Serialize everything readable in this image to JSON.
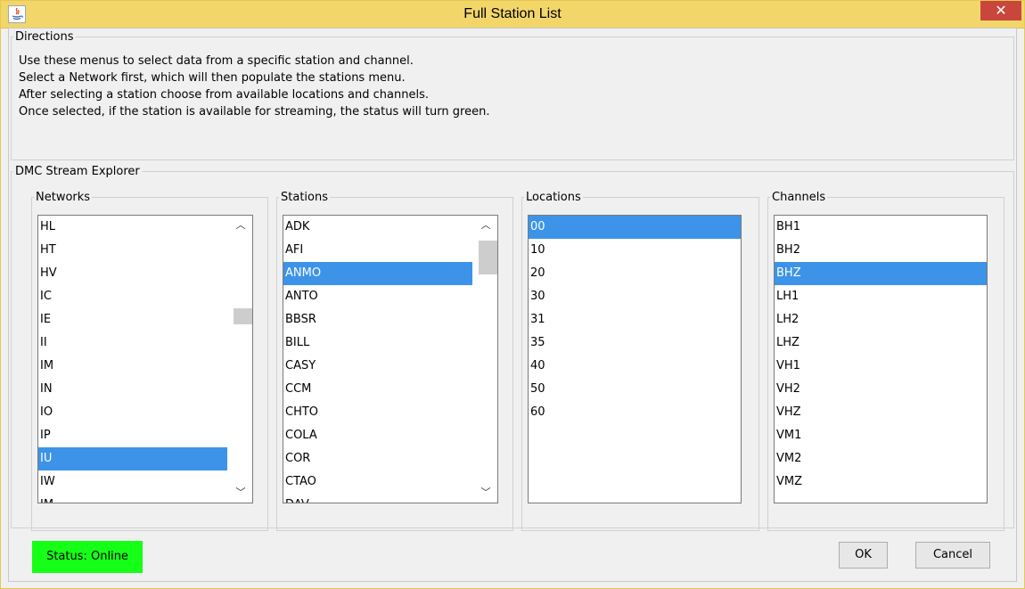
{
  "window": {
    "title": "Full Station List",
    "close_label": "✕"
  },
  "directions": {
    "legend": "Directions",
    "lines": [
      "Use these menus to select data from a specific station and channel.",
      "Select a Network first, which will then populate the stations menu.",
      "After selecting a station choose from available locations and channels.",
      "Once selected, if the station is available for streaming, the status will turn green."
    ]
  },
  "explorer": {
    "legend": "DMC Stream Explorer",
    "networks": {
      "label": "Networks",
      "items": [
        "HL",
        "HT",
        "HV",
        "IC",
        "IE",
        "II",
        "IM",
        "IN",
        "IO",
        "IP",
        "IU",
        "IW",
        "JM"
      ],
      "selected": "IU"
    },
    "stations": {
      "label": "Stations",
      "items": [
        "ADK",
        "AFI",
        "ANMO",
        "ANTO",
        "BBSR",
        "BILL",
        "CASY",
        "CCM",
        "CHTO",
        "COLA",
        "COR",
        "CTAO",
        "DAV"
      ],
      "selected": "ANMO"
    },
    "locations": {
      "label": "Locations",
      "items": [
        "00",
        "10",
        "20",
        "30",
        "31",
        "35",
        "40",
        "50",
        "60"
      ],
      "selected": "00"
    },
    "channels": {
      "label": "Channels",
      "items": [
        "BH1",
        "BH2",
        "BHZ",
        "LH1",
        "LH2",
        "LHZ",
        "VH1",
        "VH2",
        "VHZ",
        "VM1",
        "VM2",
        "VMZ"
      ],
      "selected": "BHZ"
    }
  },
  "status": {
    "text": "Status: Online",
    "color": "#16ff16"
  },
  "buttons": {
    "ok": "OK",
    "cancel": "Cancel"
  },
  "icons": {
    "app": "java-app-icon",
    "scroll_up": "chevron-up-icon",
    "scroll_down": "chevron-down-icon"
  },
  "colors": {
    "titlebar": "#f2d66a",
    "close": "#c9463d",
    "selection": "#3d93e8"
  }
}
